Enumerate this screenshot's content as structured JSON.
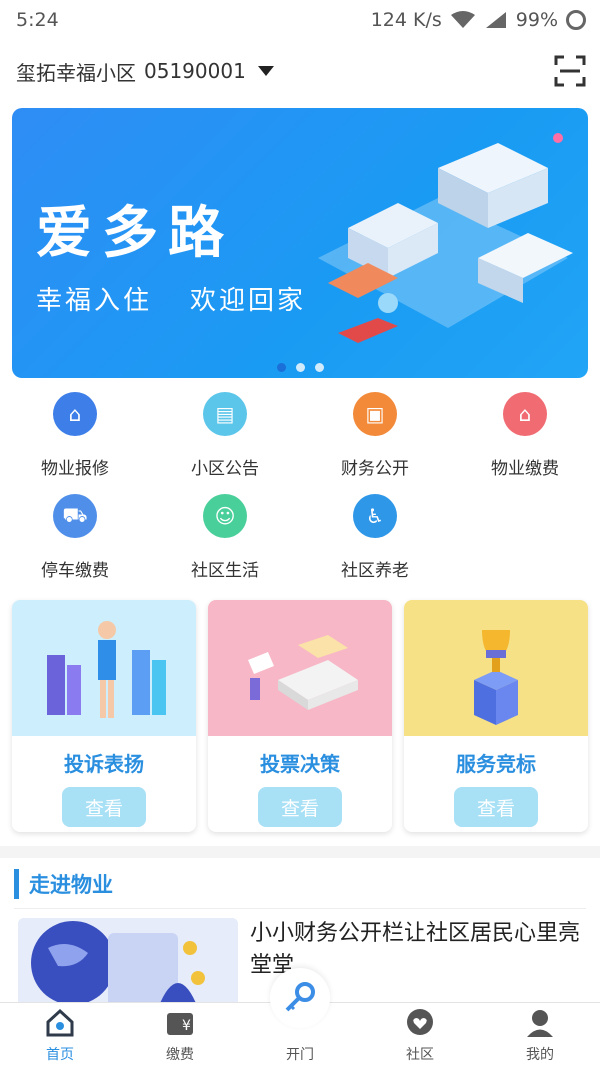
{
  "status_bar": {
    "time": "5:24",
    "network_speed": "124 K/s",
    "battery": "99%",
    "icons": [
      "wifi-icon",
      "signal-icon",
      "battery-icon"
    ]
  },
  "header": {
    "community_name": "玺拓幸福小区",
    "community_code": "05190001",
    "scan_icon": "scan-icon"
  },
  "banner": {
    "title": "爱多路",
    "subtitle_left": "幸福入住",
    "subtitle_right": "欢迎回家",
    "page_count": 3,
    "active_page": 1
  },
  "services": [
    {
      "label": "物业报修",
      "icon": "repair-icon",
      "color": "#3d7ee8"
    },
    {
      "label": "小区公告",
      "icon": "notice-icon",
      "color": "#5cc6ea"
    },
    {
      "label": "财务公开",
      "icon": "finance-icon",
      "color": "#f28a3a"
    },
    {
      "label": "物业缴费",
      "icon": "fee-icon",
      "color": "#f06b72"
    },
    {
      "label": "停车缴费",
      "icon": "parking-icon",
      "color": "#4f8fea"
    },
    {
      "label": "社区生活",
      "icon": "life-icon",
      "color": "#49cf9a"
    },
    {
      "label": "社区养老",
      "icon": "elderly-icon",
      "color": "#2f97e8"
    }
  ],
  "cards": [
    {
      "title": "投诉表扬",
      "button": "查看",
      "bg": "#cdeefc"
    },
    {
      "title": "投票决策",
      "button": "查看",
      "bg": "#f7b7c6"
    },
    {
      "title": "服务竞标",
      "button": "查看",
      "bg": "#f7e186"
    }
  ],
  "section": {
    "title": "走进物业"
  },
  "news": {
    "title": "小小财务公开栏让社区居民心里亮堂堂"
  },
  "tabbar": [
    {
      "label": "首页",
      "icon": "home-icon",
      "active": true
    },
    {
      "label": "缴费",
      "icon": "payment-icon",
      "active": false
    },
    {
      "label": "开门",
      "icon": "key-icon",
      "active": false
    },
    {
      "label": "社区",
      "icon": "community-icon",
      "active": false
    },
    {
      "label": "我的",
      "icon": "profile-icon",
      "active": false
    }
  ]
}
